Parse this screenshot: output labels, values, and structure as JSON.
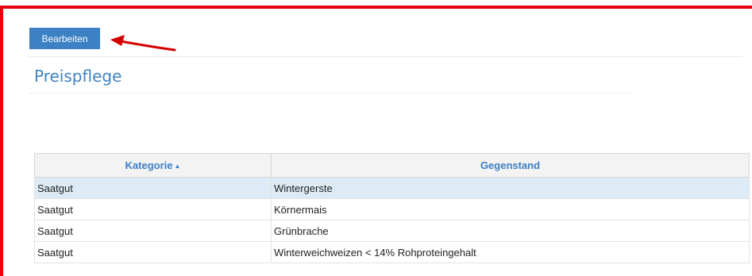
{
  "toolbar": {
    "edit_label": "Bearbeiten"
  },
  "page": {
    "title": "Preispflege"
  },
  "table": {
    "columns": [
      {
        "label": "Kategorie",
        "sort": "▲"
      },
      {
        "label": "Gegenstand"
      }
    ],
    "rows": [
      {
        "kategorie": "Saatgut",
        "gegenstand": "Wintergerste",
        "selected": true
      },
      {
        "kategorie": "Saatgut",
        "gegenstand": "Körnermais"
      },
      {
        "kategorie": "Saatgut",
        "gegenstand": "Grünbrache"
      },
      {
        "kategorie": "Saatgut",
        "gegenstand": "Winterweichweizen < 14% Rohproteingehalt"
      }
    ]
  },
  "colors": {
    "frame": "#e8000c",
    "accent": "#3b81c4",
    "selected_row": "#dcebf5",
    "arrow": "#d40000"
  },
  "annotation": {
    "icon": "red-arrow-icon",
    "points_to": "edit-button"
  }
}
